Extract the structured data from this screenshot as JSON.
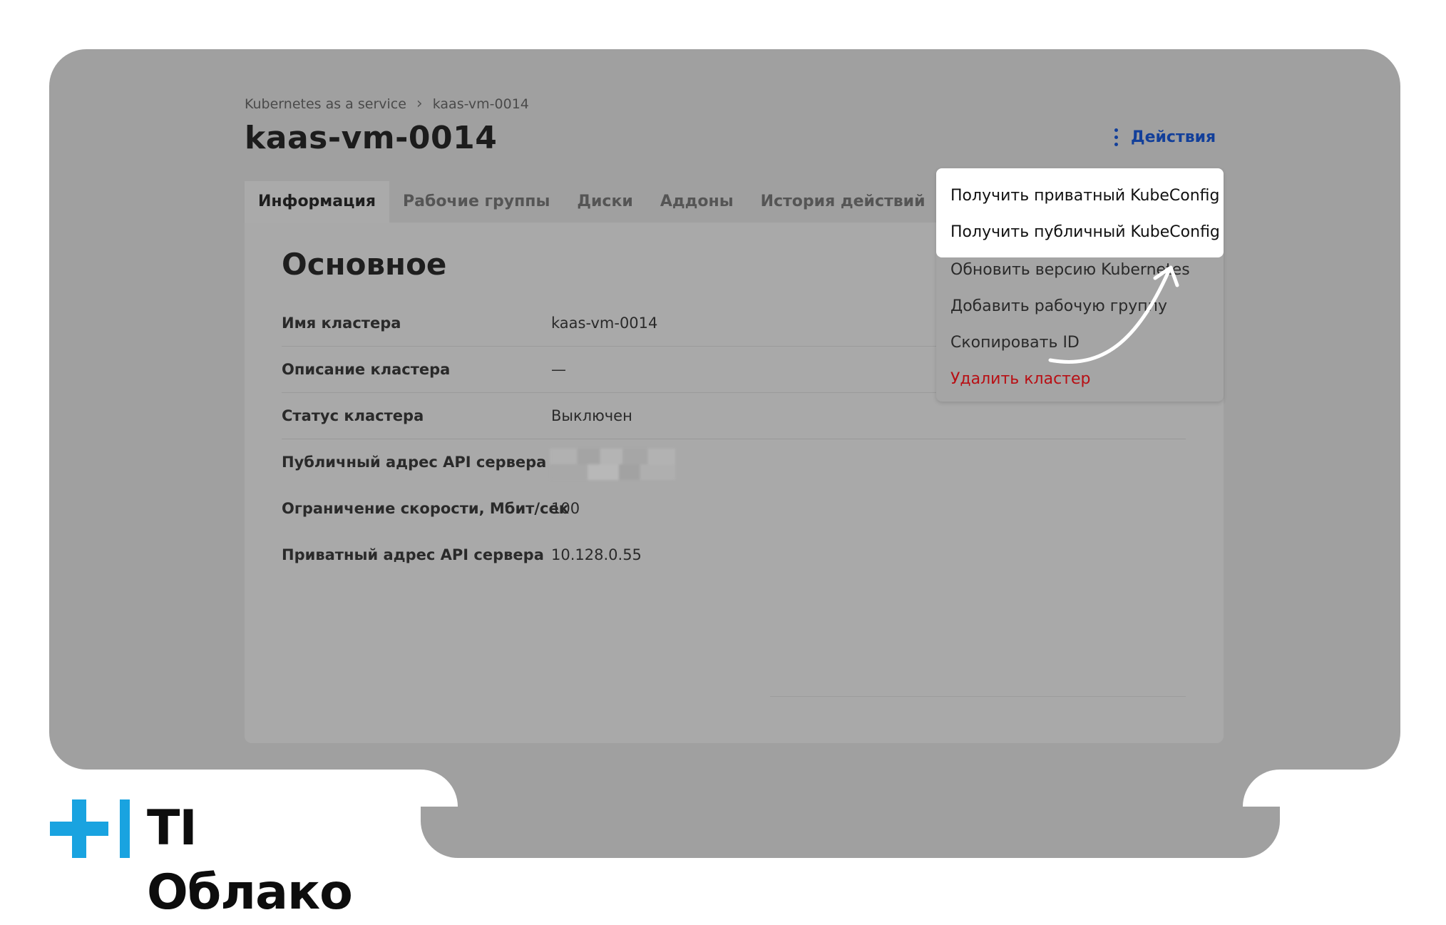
{
  "breadcrumb": {
    "items": [
      "Kubernetes as a service",
      "kaas-vm-0014"
    ]
  },
  "page": {
    "title": "kaas-vm-0014",
    "actions_label": "Действия"
  },
  "tabs": [
    "Информация",
    "Рабочие группы",
    "Диски",
    "Аддоны",
    "История действий"
  ],
  "section": {
    "title": "Основное",
    "rows": [
      {
        "label": "Имя кластера",
        "value": "kaas-vm-0014"
      },
      {
        "label": "Описание кластера",
        "value": "—"
      },
      {
        "label": "Статус кластера",
        "value": "Выключен"
      },
      {
        "label": "Публичный адрес API сервера",
        "value": ""
      },
      {
        "label": "Ограничение скорости, Мбит/сек",
        "value": "100"
      },
      {
        "label": "Приватный адрес API сервера",
        "value": "10.128.0.55"
      }
    ]
  },
  "menu": {
    "items": [
      "Получить приватный KubeConfig",
      "Получить публичный KubeConfig",
      "Обновить версию Kubernetes",
      "Добавить рабочую группу",
      "Скопировать ID",
      "Удалить кластер"
    ]
  },
  "logo": {
    "text": "TI Облако"
  },
  "colors": {
    "accent": "#123f9a",
    "danger": "#b80f14",
    "brand": "#19a3e0",
    "overlay": "#a0a0a0"
  }
}
